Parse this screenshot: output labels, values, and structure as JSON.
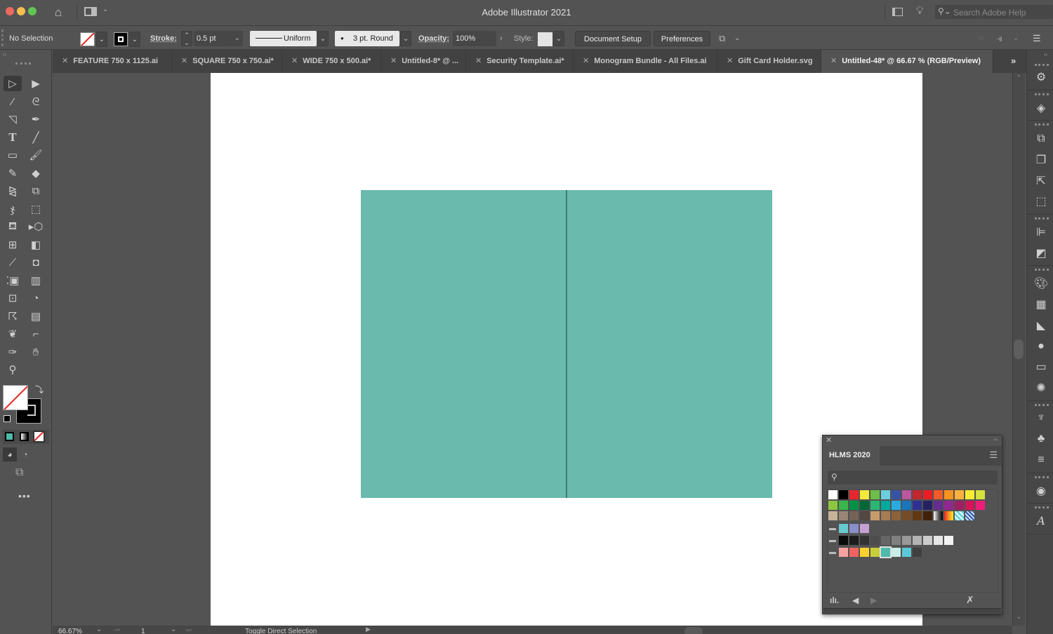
{
  "app": {
    "title": "Adobe Illustrator 2021"
  },
  "titlebar": {
    "search_placeholder": "Search Adobe Help"
  },
  "control_bar": {
    "selection_label": "No Selection",
    "stroke_label": "Stroke:",
    "stroke_weight": "0.5 pt",
    "variable_width": "Uniform",
    "brush": "3 pt. Round",
    "opacity_label": "Opacity:",
    "opacity_value": "100%",
    "style_label": "Style:",
    "document_setup": "Document Setup",
    "preferences": "Preferences"
  },
  "tabs": [
    {
      "label": "FEATURE 750 x 1125.ai",
      "active": false
    },
    {
      "label": "SQUARE 750 x 750.ai*",
      "active": false
    },
    {
      "label": "WIDE 750 x 500.ai*",
      "active": false
    },
    {
      "label": "Untitled-8* @ ...",
      "active": false
    },
    {
      "label": "Security Template.ai*",
      "active": false
    },
    {
      "label": "Monogram Bundle - All Files.ai",
      "active": false
    },
    {
      "label": "Gift Card Holder.svg",
      "active": false
    },
    {
      "label": "Untitled-48* @ 66.67 % (RGB/Preview)",
      "active": true
    }
  ],
  "tools": [
    "selection-tool",
    "direct-selection-tool",
    "magic-wand-tool",
    "lasso-tool",
    "curvature-tool",
    "pen-tool",
    "type-tool",
    "line-segment-tool",
    "rectangle-tool",
    "paintbrush-tool",
    "pencil-tool",
    "eraser-tool",
    "reflect-tool",
    "scale-tool",
    "warp-tool",
    "free-transform-tool",
    "live-paint-bucket-tool",
    "perspective-grid-tool",
    "mesh-tool",
    "gradient-tool",
    "eyedropper-tool",
    "blend-tool",
    "symbol-sprayer-tool",
    "graph-tool",
    "artboard-tool",
    "slice-tool",
    "puppet-warp-tool",
    "measure-tool",
    "butterfly-tool",
    "crop-tool",
    "knife-tool",
    "hand-tool",
    "zoom-tool"
  ],
  "artwork": {
    "fill_color": "#6abaad",
    "fold_color": "#3d7d73"
  },
  "swatches_panel": {
    "title": "HLMS 2020",
    "search_placeholder": "",
    "rows": [
      [
        "#ffffff",
        "#000000",
        "#e8262d",
        "#f2e93b",
        "#6cbe4a",
        "#6ccedc",
        "#3754a4",
        "#b9579f",
        "#c1272d",
        "#ec1c24",
        "#f15a29",
        "#f7931e",
        "#fbb040",
        "#f9ed32",
        "#d7e13e"
      ],
      [
        "#8dc63f",
        "#39b54a",
        "#009245",
        "#006837",
        "#2bb673",
        "#00a99d",
        "#29abe2",
        "#1b75bc",
        "#2e3192",
        "#262262",
        "#662d91",
        "#92278f",
        "#9e1f63",
        "#d4145a",
        "#ed1e79"
      ],
      [
        "#c7b299",
        "#998675",
        "#736357",
        "#534741",
        "#c69c6d",
        "#a67c52",
        "#8c6239",
        "#754c24",
        "#603813",
        "#42210b",
        "gradient-gray",
        "gradient-orange",
        "pattern-cyan",
        "pattern-blue"
      ]
    ],
    "groups": [
      [
        "#68c9d0",
        "#8a8fc9",
        "#c5a1d3"
      ],
      [
        "#0a0a0a",
        "#1c1c1c",
        "#333333",
        "#4d4d4d",
        "#666666",
        "#808080",
        "#999999",
        "#b3b3b3",
        "#cccccc",
        "#e6e6e6",
        "#f2f2f2"
      ],
      [
        "#f4a3a1",
        "#ef6461",
        "#fcd130",
        "#c8cf3b",
        "#4ebaa9",
        "#c9ece6",
        "#5bc8d8",
        "#404040"
      ]
    ],
    "selected": "#4ebaa9"
  },
  "status_bar": {
    "zoom": "66.67%",
    "artboard": "1",
    "tool_hint": "Toggle Direct Selection"
  }
}
